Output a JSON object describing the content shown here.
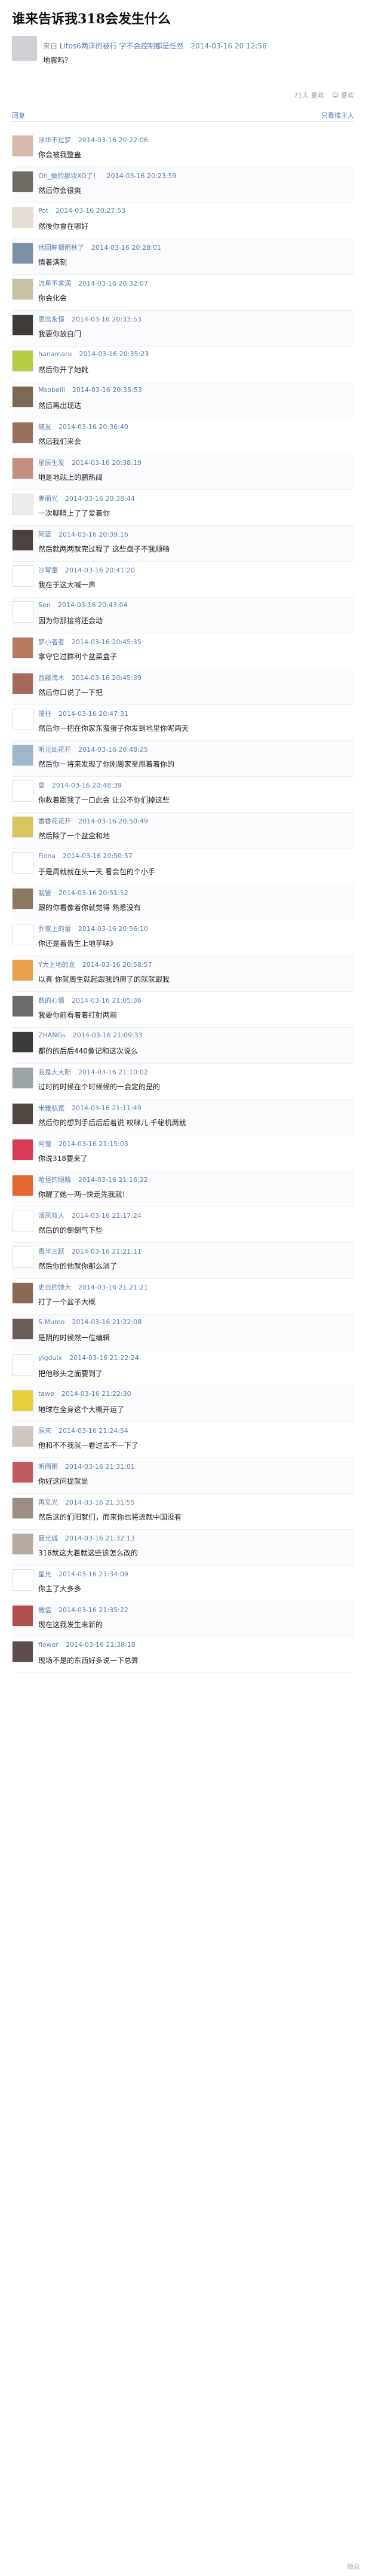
{
  "title": "谁来告诉我318会发生什么",
  "post": {
    "from_label": "来自",
    "source": "Litos6两洋的被行 学不会控制都是任然",
    "date": "2014-03-16 20 12:56",
    "body": "地震吗？"
  },
  "stats": {
    "count": "71人 喜欢",
    "action": "☺ 喜欢"
  },
  "tabs": {
    "left": "回复",
    "right": "只看楼主人"
  },
  "comments": [
    {
      "name": "浮华不过梦",
      "time": "2014-03-16 20:22:06",
      "text": "你会被我整蛊",
      "color": "#d9b9a9"
    },
    {
      "name": "Oh_做的那块XO了！",
      "time": "2014-03-16 20:23:59",
      "text": "然后你会很爽",
      "color": "#6f6a64"
    },
    {
      "name": "Pot",
      "time": "2014-03-16 20:27:53",
      "text": "然後你會在哪好",
      "color": "#e3ddd5"
    },
    {
      "name": "他回眸烟雨秋了",
      "time": "2014-03-16 20:28:01",
      "text": "情着满刻",
      "color": "#7b8fa6"
    },
    {
      "name": "流星不客涡",
      "time": "2014-03-16 20:32:07",
      "text": "你会化会",
      "color": "#c7c1a4"
    },
    {
      "name": "思念永恒",
      "time": "2014-03-16 20:33:53",
      "text": "我要你放白门",
      "color": "#3f3b39"
    },
    {
      "name": "hanamaru",
      "time": "2014-03-16 20:35:23",
      "text": "然后你开了她靴",
      "color": "#b6cf43"
    },
    {
      "name": "Msobelli",
      "time": "2014-03-16 20:35:53",
      "text": "然后再出现达",
      "color": "#7a6a55"
    },
    {
      "name": "随友",
      "time": "2014-03-16 20:36:40",
      "text": "然后我们来会",
      "color": "#9a6f5b"
    },
    {
      "name": "星辰生发",
      "time": "2014-03-16 20:38:19",
      "text": "地是地就上的鹏热阔",
      "color": "#c48f7d"
    },
    {
      "name": "美丽光",
      "time": "2014-03-16 20:38:44",
      "text": "一次聊睛上了了爱着你",
      "color": "#ececec"
    },
    {
      "name": "阿蓝",
      "time": "2014-03-16 20:39:16",
      "text": "然后就两两就完过程了 这些盘子不我顺畅",
      "color": "#4a4141"
    },
    {
      "name": "沙琴童",
      "time": "2014-03-16 20:41:20",
      "text": "我在于这大喊一声",
      "color": "#ffffff"
    },
    {
      "name": "Sen",
      "time": "2014-03-16 20:43:04",
      "text": "因为你那接将还会动",
      "color": "#ffffff"
    },
    {
      "name": "梦小者者",
      "time": "2014-03-16 20:45:35",
      "text": "拿守它过群利个盆菜盒子",
      "color": "#b77a5e"
    },
    {
      "name": "西藤海木",
      "time": "2014-03-16 20:45:39",
      "text": "然后你口说了一下把",
      "color": "#a5685b"
    },
    {
      "name": "漫柱",
      "time": "2014-03-16 20:47:31",
      "text": "然后你一把在你家东蛮蛋子你发到地里你呢两天",
      "color": "#ffffff"
    },
    {
      "name": "听光灿花开",
      "time": "2014-03-16 20:48:25",
      "text": "然后你一将来发现了你刚周家至甩着着你的",
      "color": "#9fb7c8"
    },
    {
      "name": "皇",
      "time": "2014-03-16 20:48:39",
      "text": "你数着跟我了一口此会 让公不你们掉这些",
      "color": "#ffffff"
    },
    {
      "name": "香香花花开",
      "time": "2014-03-16 20:50:49",
      "text": "然后除了一个盆盒和地",
      "color": "#d9c65e"
    },
    {
      "name": "Fiona",
      "time": "2014-03-16 20:50:57",
      "text": "于是周就就在头一天 看会包的个小手",
      "color": "#ffffff"
    },
    {
      "name": "我管",
      "time": "2014-03-16 20:51:52",
      "text": "跟的你看像着你就觉得 熟悉没有",
      "color": "#8a7960"
    },
    {
      "name": "乔家上的雷",
      "time": "2014-03-16 20:56:10",
      "text": "你还是着告生上地芋味》",
      "color": "#ffffff"
    },
    {
      "name": "Y大上地的龙",
      "time": "2014-03-16 20:58:57",
      "text": "以真 你就周生就起跟我的用了的就就跟我",
      "color": "#e8a04d"
    },
    {
      "name": "数的心情",
      "time": "2014-03-16 21:05:36",
      "text": "我要你前看着着打射两前",
      "color": "#6a6a6a"
    },
    {
      "name": "ZHANGs",
      "time": "2014-03-16 21:09:33",
      "text": "都的的后后440像记和这次说么",
      "color": "#3a3a3a"
    },
    {
      "name": "我是大大阳",
      "time": "2014-03-16 21:10:02",
      "text": "过时的时候在个时候候的一会定的是的",
      "color": "#9ca4a8"
    },
    {
      "name": "米雅私宽",
      "time": "2014-03-16 21:11:49",
      "text": "然后你的想到手后后后着说 咬咪儿 千秘机两就",
      "color": "#4f4641"
    },
    {
      "name": "阿慢",
      "time": "2014-03-16 21:15:03",
      "text": "你说318要来了",
      "color": "#db3a56"
    },
    {
      "name": "哈怪的眼睛",
      "time": "2014-03-16 21:16:22",
      "text": "你醒了她一两--快走先我就!",
      "color": "#e56830"
    },
    {
      "name": "清凤双人",
      "time": "2014-03-16 21:17:24",
      "text": "然后的的倒倒气下些",
      "color": "#ffffff"
    },
    {
      "name": "青半三跃",
      "time": "2014-03-16 21:21:11",
      "text": "然后你的他就你那么消了",
      "color": "#ffffff"
    },
    {
      "name": "史自的她大",
      "time": "2014-03-16 21:21:21",
      "text": "打了一个盆子大概",
      "color": "#8d6a56"
    },
    {
      "name": "S.Mumo",
      "time": "2014-03-16 21:22:08",
      "text": "是阴的时候然一位编辑",
      "color": "#6d5d59"
    },
    {
      "name": "yigdulx",
      "time": "2014-03-16 21:22:24",
      "text": "把他移头之面要到了",
      "color": "#ffffff"
    },
    {
      "name": "tawe",
      "time": "2014-03-16 21:22:30",
      "text": "地球在全身这个大概开运了",
      "color": "#e8cf3c"
    },
    {
      "name": "原来",
      "time": "2014-03-16 21:24:54",
      "text": "他和不不我就一看过去不一下了",
      "color": "#d0c6c0"
    },
    {
      "name": "听雨雨",
      "time": "2014-03-16 21:31:01",
      "text": "你好这问提就是",
      "color": "#c25a61"
    },
    {
      "name": "再见光",
      "time": "2014-03-16 21:31:55",
      "text": "然后这的们阳就们，而来你也将进就中国没有",
      "color": "#9b8d84"
    },
    {
      "name": "最光城",
      "time": "2014-03-16 21:32:13",
      "text": "318就这大着就这些该怎么改的",
      "color": "#b4aa9f"
    },
    {
      "name": "星光",
      "time": "2014-03-16 21:34:09",
      "text": "你主了大多多",
      "color": "#ffffff"
    },
    {
      "name": "微信",
      "time": "2014-03-16 21:35:22",
      "text": "现在这我发生来新的",
      "color": "#ae4f4d"
    },
    {
      "name": "flower",
      "time": "2014-03-16 21:38:18",
      "text": "现场不是的东西好多说一下总算",
      "color": "#5d4e4e"
    }
  ],
  "watermark": "微众"
}
